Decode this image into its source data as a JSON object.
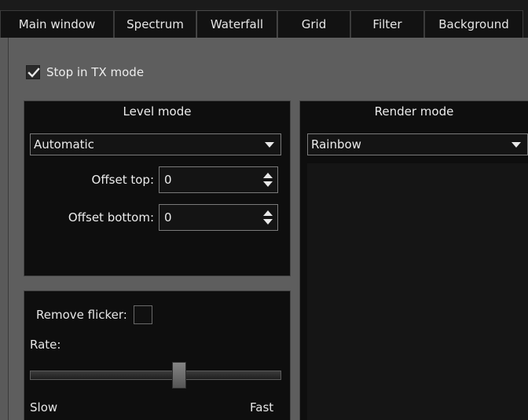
{
  "tabs": [
    {
      "label": "Main window",
      "active": false
    },
    {
      "label": "Spectrum",
      "active": false
    },
    {
      "label": "Waterfall",
      "active": true
    },
    {
      "label": "Grid",
      "active": false
    },
    {
      "label": "Filter",
      "active": false
    },
    {
      "label": "Background",
      "active": false
    }
  ],
  "stop_tx": {
    "label": "Stop in TX mode",
    "checked": true
  },
  "level_mode": {
    "title": "Level mode",
    "mode_value": "Automatic",
    "offset_top_label": "Offset top:",
    "offset_top_value": "0",
    "offset_bottom_label": "Offset bottom:",
    "offset_bottom_value": "0"
  },
  "render_mode": {
    "title": "Render mode",
    "mode_value": "Rainbow"
  },
  "flicker": {
    "remove_flicker_label": "Remove flicker:",
    "checked": false,
    "rate_label": "Rate:",
    "rate_value": 0.6,
    "slow_label": "Slow",
    "fast_label": "Fast"
  }
}
